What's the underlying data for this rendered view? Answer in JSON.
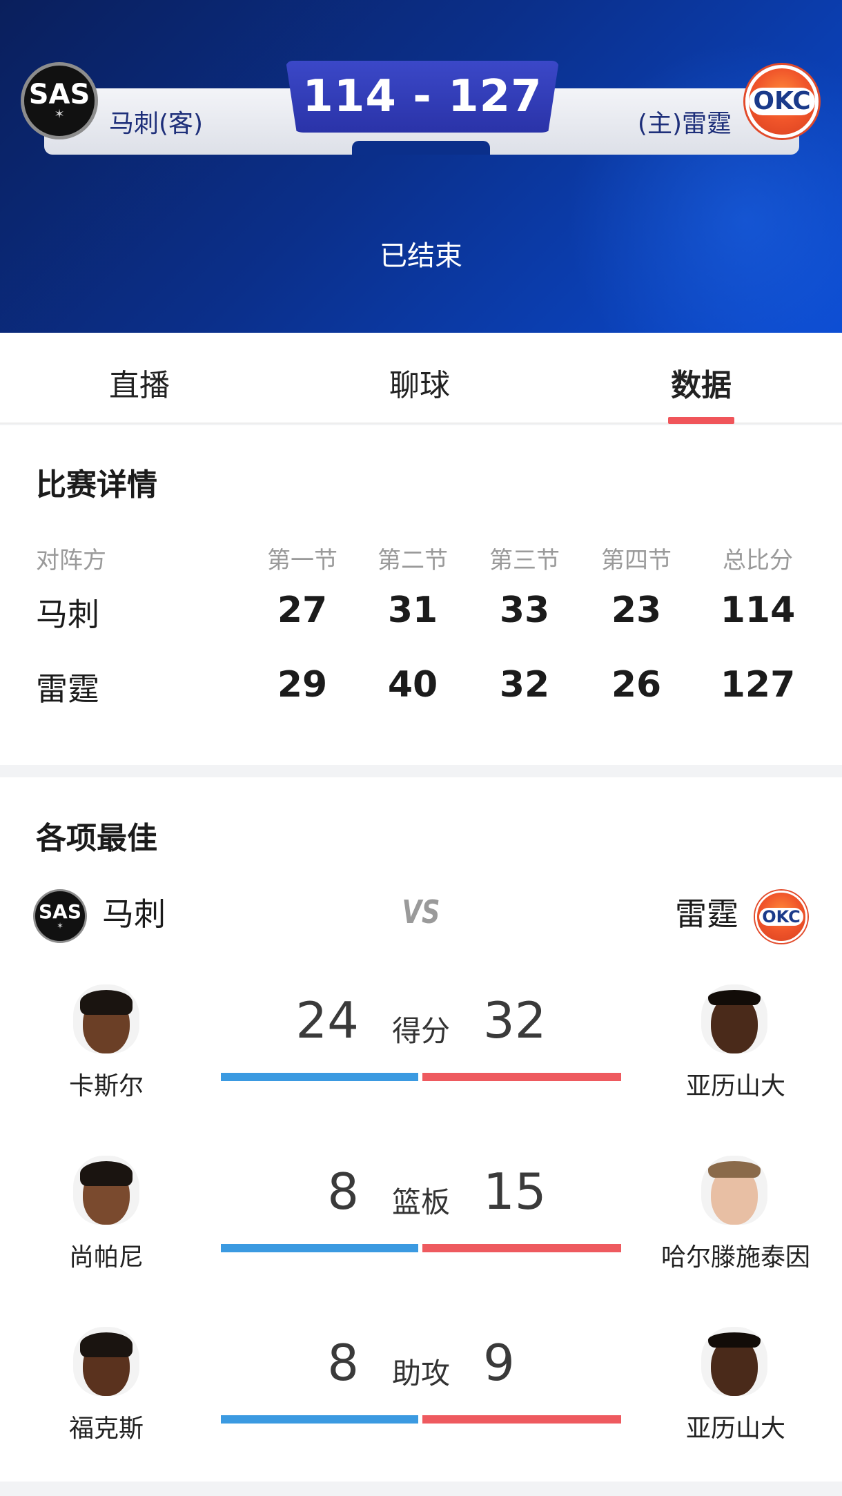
{
  "header": {
    "score": "114 - 127",
    "away_logo_text": "SAS",
    "away_name": "马刺(客)",
    "home_logo_text": "OKC",
    "home_name": "(主)雷霆",
    "status": "已结束",
    "colors": {
      "bg_start": "#0a1f5c",
      "bg_end": "#0b4bd1",
      "score_box": "#3b48c8"
    }
  },
  "tabs": [
    {
      "label": "直播",
      "active": false
    },
    {
      "label": "聊球",
      "active": false
    },
    {
      "label": "数据",
      "active": true
    }
  ],
  "details": {
    "title": "比赛详情",
    "headers": [
      "对阵方",
      "第一节",
      "第二节",
      "第三节",
      "第四节",
      "总比分"
    ],
    "rows": [
      {
        "team": "马刺",
        "q1": "27",
        "q2": "31",
        "q3": "33",
        "q4": "23",
        "total": "114"
      },
      {
        "team": "雷霆",
        "q1": "29",
        "q2": "40",
        "q3": "32",
        "q4": "26",
        "total": "127"
      }
    ]
  },
  "leaders": {
    "title": "各项最佳",
    "left_team": "马刺",
    "right_team": "雷霆",
    "left_logo_text": "SAS",
    "right_logo_text": "OKC",
    "vs": "VS",
    "stats": [
      {
        "label": "得分",
        "left_value": "24",
        "right_value": "32",
        "left_player": "卡斯尔",
        "right_player": "亚历山大"
      },
      {
        "label": "篮板",
        "left_value": "8",
        "right_value": "15",
        "left_player": "尚帕尼",
        "right_player": "哈尔滕施泰因"
      },
      {
        "label": "助攻",
        "left_value": "8",
        "right_value": "9",
        "left_player": "福克斯",
        "right_player": "亚历山大"
      }
    ],
    "colors": {
      "left_bar": "#3b9ae1",
      "right_bar": "#ee5a5f",
      "tab_underline": "#f0555a"
    }
  }
}
